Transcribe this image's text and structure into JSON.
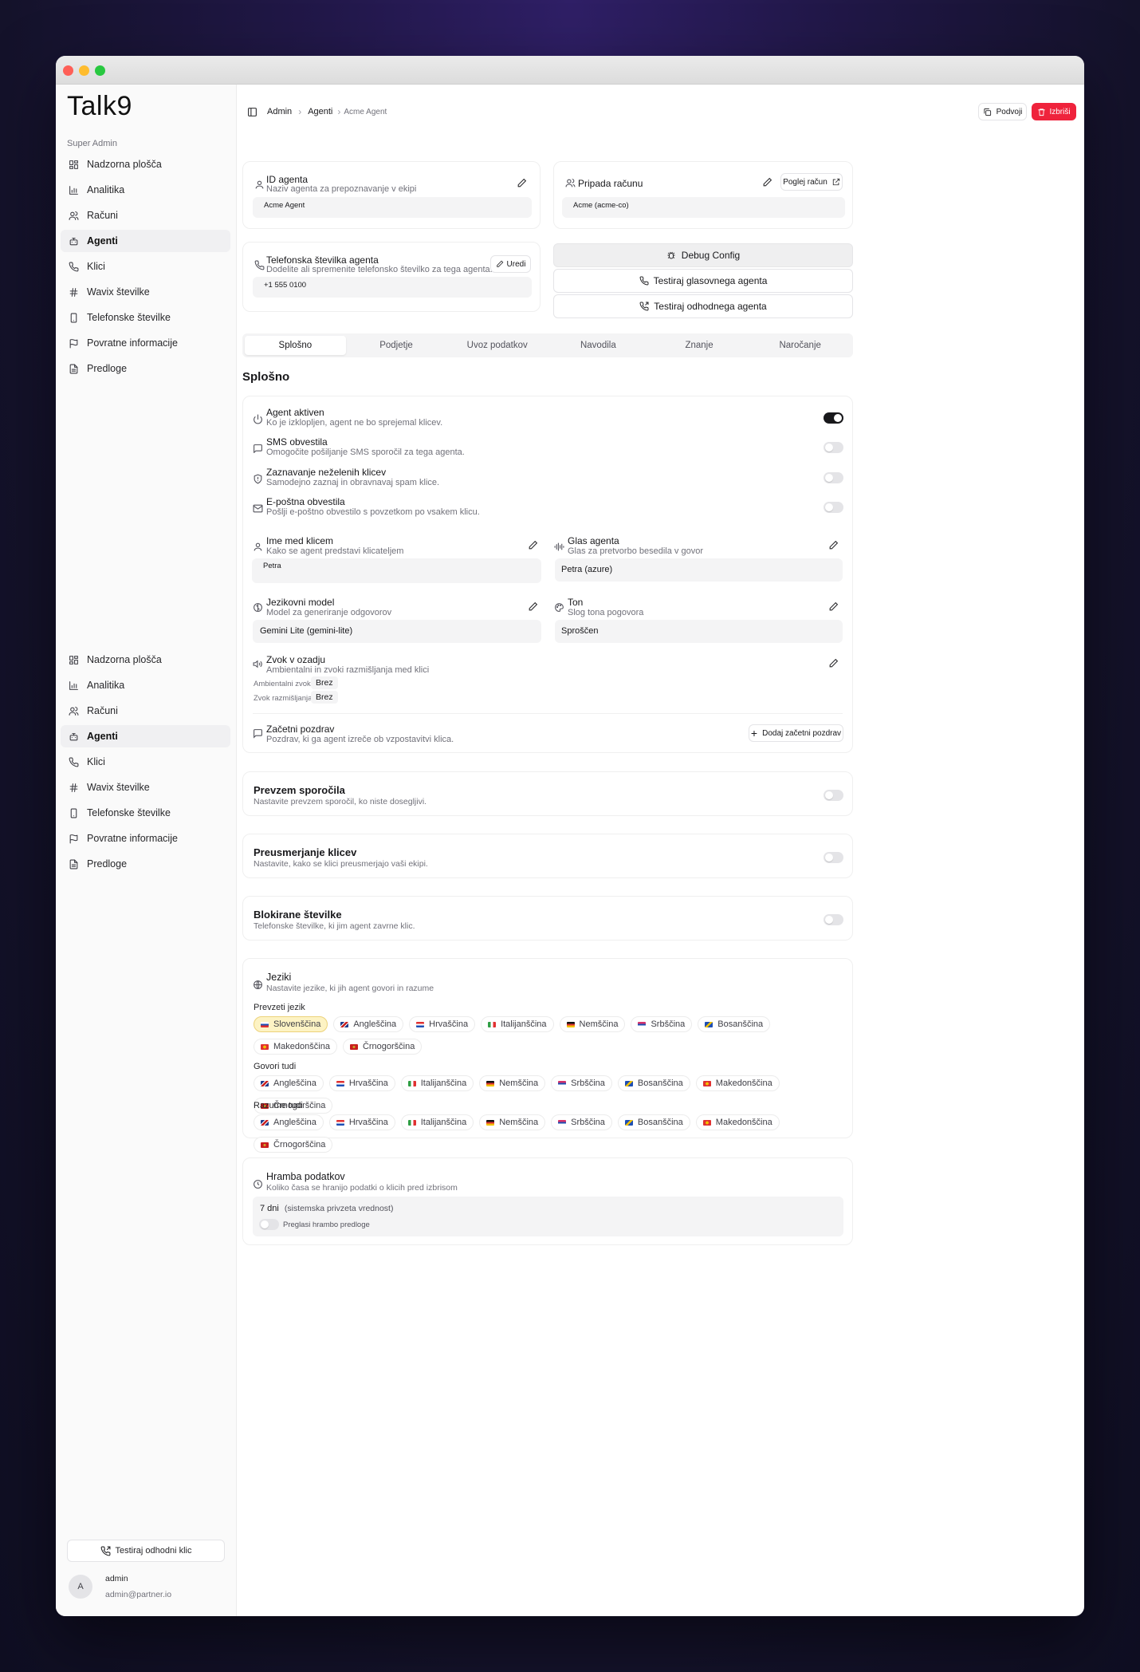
{
  "app": {
    "logo": "Talk9",
    "section_label": "Super Admin"
  },
  "sidebar": {
    "items": [
      {
        "label": "Nadzorna plošča",
        "icon": "dashboard-icon"
      },
      {
        "label": "Analitika",
        "icon": "chart-icon"
      },
      {
        "label": "Računi",
        "icon": "users-icon"
      },
      {
        "label": "Agenti",
        "icon": "bot-icon",
        "active": true
      },
      {
        "label": "Klici",
        "icon": "phone-icon"
      },
      {
        "label": "Wavix številke",
        "icon": "hash-icon"
      },
      {
        "label": "Telefonske številke",
        "icon": "smartphone-icon"
      },
      {
        "label": "Povratne informacije",
        "icon": "flag-icon"
      },
      {
        "label": "Predloge",
        "icon": "file-icon"
      }
    ],
    "test_call_label": "Testiraj odhodni klic",
    "user": {
      "initial": "A",
      "name": "admin",
      "email": "admin@partner.io"
    }
  },
  "breadcrumb": {
    "root": "Admin",
    "section": "Agenti",
    "current": "Acme Agent"
  },
  "toolbar": {
    "duplicate_label": "Podvoji",
    "delete_label": "Izbriši"
  },
  "agent_id": {
    "title": "ID agenta",
    "subtitle": "Naziv agenta za prepoznavanje v ekipi",
    "value": "Acme Agent"
  },
  "account": {
    "title": "Pripada računu",
    "button": "Poglej račun",
    "value": "Acme (acme-co)"
  },
  "phone": {
    "title": "Telefonska številka agenta",
    "subtitle": "Dodelite ali spremenite telefonsko številko za tega agenta.",
    "edit_label": "Uredi",
    "value": "+1 555 0100"
  },
  "actions": {
    "debug": "Debug Config",
    "test_voice": "Testiraj glasovnega agenta",
    "test_outbound": "Testiraj odhodnega agenta"
  },
  "tabs": [
    "Splošno",
    "Podjetje",
    "Uvoz podatkov",
    "Navodila",
    "Znanje",
    "Naročanje"
  ],
  "general": {
    "heading": "Splošno",
    "toggles": [
      {
        "title": "Agent aktiven",
        "subtitle": "Ko je izklopljen, agent ne bo sprejemal klicev.",
        "on": true,
        "icon": "power-icon"
      },
      {
        "title": "SMS obvestila",
        "subtitle": "Omogočite pošiljanje SMS sporočil za tega agenta.",
        "on": false,
        "icon": "message-icon"
      },
      {
        "title": "Zaznavanje neželenih klicev",
        "subtitle": "Samodejno zaznaj in obravnavaj spam klice.",
        "on": false,
        "icon": "shield-icon"
      },
      {
        "title": "E-poštna obvestila",
        "subtitle": "Pošlji e-poštno obvestilo s povzetkom po vsakem klicu.",
        "on": false,
        "icon": "mail-icon"
      }
    ],
    "caller_name": {
      "title": "Ime med klicem",
      "subtitle": "Kako se agent predstavi klicateljem",
      "value": "Petra"
    },
    "voice": {
      "title": "Glas agenta",
      "subtitle": "Glas za pretvorbo besedila v govor",
      "value": "Petra (azure)"
    },
    "model": {
      "title": "Jezikovni model",
      "subtitle": "Model za generiranje odgovorov",
      "value": "Gemini Lite (gemini-lite)"
    },
    "tone": {
      "title": "Ton",
      "subtitle": "Slog tona pogovora",
      "value": "Sproščen"
    },
    "background": {
      "title": "Zvok v ozadju",
      "subtitle": "Ambientalni in zvoki razmišljanja med klici",
      "ambient_label": "Ambientalni zvok:",
      "ambient_value": "Brez",
      "thinking_label": "Zvok razmišljanja:",
      "thinking_value": "Brez"
    },
    "greeting": {
      "title": "Začetni pozdrav",
      "subtitle": "Pozdrav, ki ga agent izreče ob vzpostavitvi klica.",
      "button": "Dodaj začetni pozdrav"
    }
  },
  "voicemail": {
    "title": "Prevzem sporočila",
    "subtitle": "Nastavite prevzem sporočil, ko niste dosegljivi.",
    "on": false
  },
  "forwarding": {
    "title": "Preusmerjanje klicev",
    "subtitle": "Nastavite, kako se klici preusmerjajo vaši ekipi.",
    "on": false
  },
  "blocked": {
    "title": "Blokirane številke",
    "subtitle": "Telefonske številke, ki jim agent zavrne klic.",
    "on": false
  },
  "languages": {
    "title": "Jeziki",
    "subtitle": "Nastavite jezike, ki jih agent govori in razume",
    "default_label": "Prevzeti jezik",
    "default_options": [
      "Slovenščina",
      "Angleščina",
      "Hrvaščina",
      "Italijanščina",
      "Nemščina",
      "Srbščina",
      "Bosanščina",
      "Makedonščina",
      "Črnogorščina"
    ],
    "selected": "Slovenščina",
    "speaks_label": "Govori tudi",
    "speaks": [
      "Angleščina",
      "Hrvaščina",
      "Italijanščina",
      "Nemščina",
      "Srbščina",
      "Bosanščina",
      "Makedonščina",
      "Črnogorščina"
    ],
    "understands_label": "Razume tudi",
    "understands": [
      "Angleščina",
      "Hrvaščina",
      "Italijanščina",
      "Nemščina",
      "Srbščina",
      "Bosanščina",
      "Makedonščina",
      "Črnogorščina"
    ]
  },
  "retention": {
    "title": "Hramba podatkov",
    "subtitle": "Koliko časa se hranijo podatki o klicih pred izbrisom",
    "days": "7 dni",
    "note": "(sistemska privzeta vrednost)",
    "override_label": "Preglasi hrambo predloge",
    "on": false
  },
  "colors": {
    "accent_delete": "#ef233c",
    "toggle_on": "#18181b",
    "selected_chip": "#fdf3c4"
  }
}
